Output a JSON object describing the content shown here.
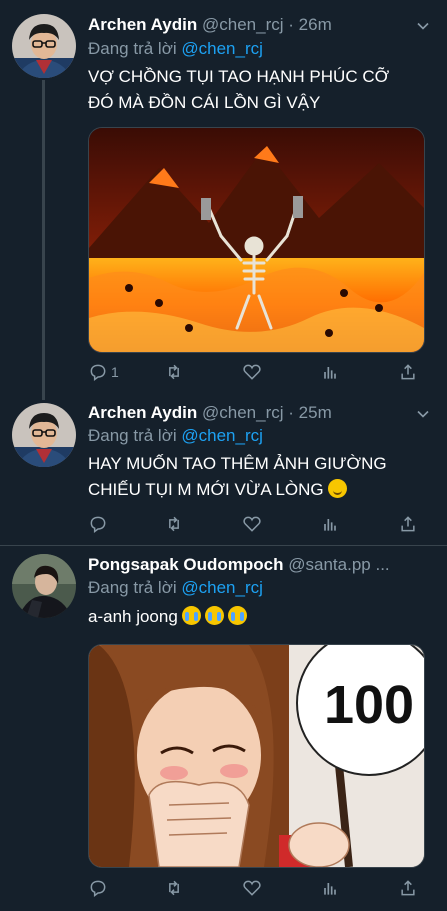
{
  "tweets": [
    {
      "author": "Archen Aydin",
      "handle": "@chen_rcj",
      "separator": "·",
      "time": "26m",
      "reply_prefix": "Đang trả lời",
      "reply_mention": "@chen_rcj",
      "text": "VỢ CHỒNG TỤI TAO HẠNH PHÚC CỠ ĐÓ MÀ ĐỒN CÁI LỒN GÌ VẬY",
      "media_icon": "skeleton-in-hell-image",
      "actions": {
        "reply_count": "1",
        "retweet_count": "",
        "like_count": ""
      }
    },
    {
      "author": "Archen Aydin",
      "handle": "@chen_rcj",
      "separator": "·",
      "time": "25m",
      "reply_prefix": "Đang trả lời",
      "reply_mention": "@chen_rcj",
      "text": "HAY MUỐN TAO THÊM ẢNH GIƯỜNG CHIẾU TỤI M MỚI VỪA LÒNG",
      "emoji": "slightly-smiling-face",
      "actions": {
        "reply_count": "",
        "retweet_count": "",
        "like_count": ""
      }
    },
    {
      "author": "Pongsapak Oudompoch",
      "handle": "@santa.pp ...",
      "reply_prefix": "Đang trả lời",
      "reply_mention": "@chen_rcj",
      "text": "a-anh joong",
      "emoji": "loudly-crying-face",
      "media_icon": "manga-panel-image",
      "media_text": "100",
      "actions": {
        "reply_count": "",
        "retweet_count": "",
        "like_count": ""
      }
    }
  ],
  "colors": {
    "background": "#15202b",
    "secondary_text": "#8899a6",
    "link": "#1da1f2",
    "divider": "#38444d"
  }
}
